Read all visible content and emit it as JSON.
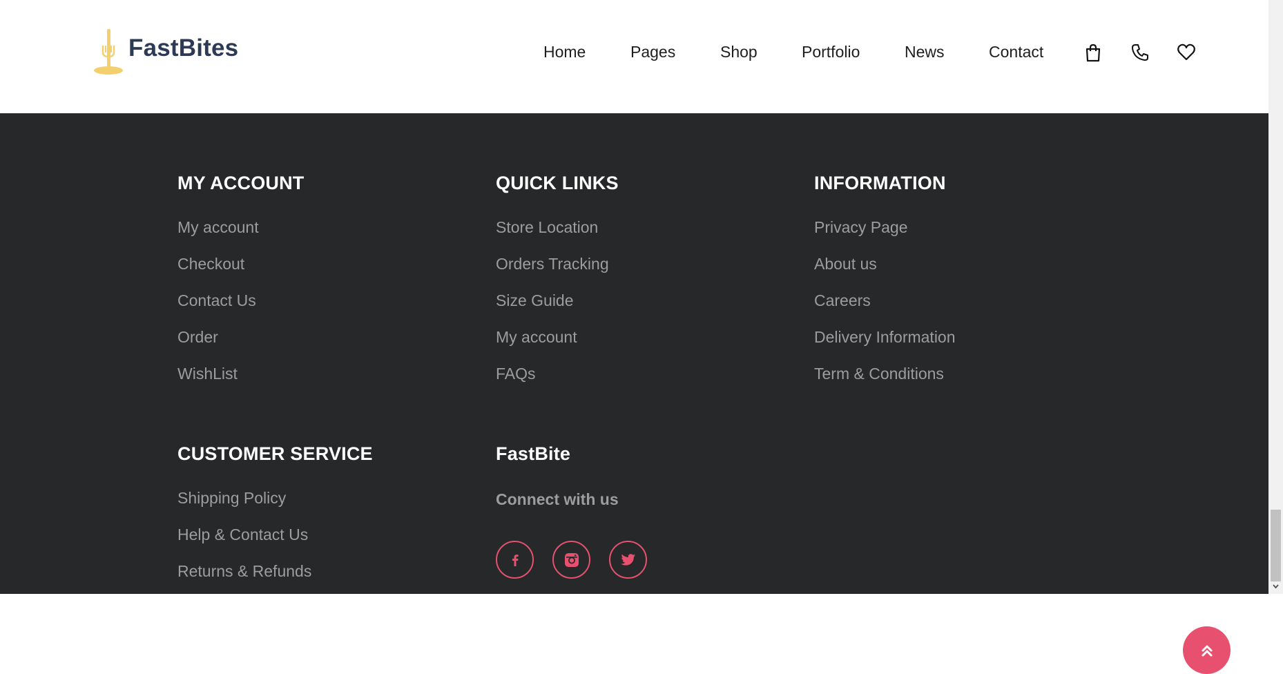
{
  "brand": {
    "name": "FastBites"
  },
  "nav": {
    "items": [
      "Home",
      "Pages",
      "Shop",
      "Portfolio",
      "News",
      "Contact"
    ]
  },
  "header_icons": [
    "shopping-bag-icon",
    "phone-icon",
    "heart-icon"
  ],
  "footer": {
    "my_account": {
      "title": "MY ACCOUNT",
      "links": [
        "My account",
        "Checkout",
        "Contact Us",
        "Order",
        "WishList"
      ]
    },
    "quick_links": {
      "title": "QUICK LINKS",
      "links": [
        "Store Location",
        "Orders Tracking",
        "Size Guide",
        "My account",
        "FAQs"
      ]
    },
    "information": {
      "title": "INFORMATION",
      "links": [
        "Privacy Page",
        "About us",
        "Careers",
        "Delivery Information",
        "Term & Conditions"
      ]
    },
    "customer_service": {
      "title": "CUSTOMER SERVICE",
      "links": [
        "Shipping Policy",
        "Help & Contact Us",
        "Returns & Refunds"
      ]
    },
    "fastbite": {
      "title": "FastBite",
      "connect": "Connect with us",
      "social": [
        "facebook-icon",
        "instagram-icon",
        "twitter-icon"
      ]
    }
  },
  "colors": {
    "footer_bg": "#272829",
    "accent": "#e8506f",
    "logo_text": "#2d3a55",
    "logo_mark": "#f3cf6e",
    "link_gray": "#9d9d9d"
  }
}
